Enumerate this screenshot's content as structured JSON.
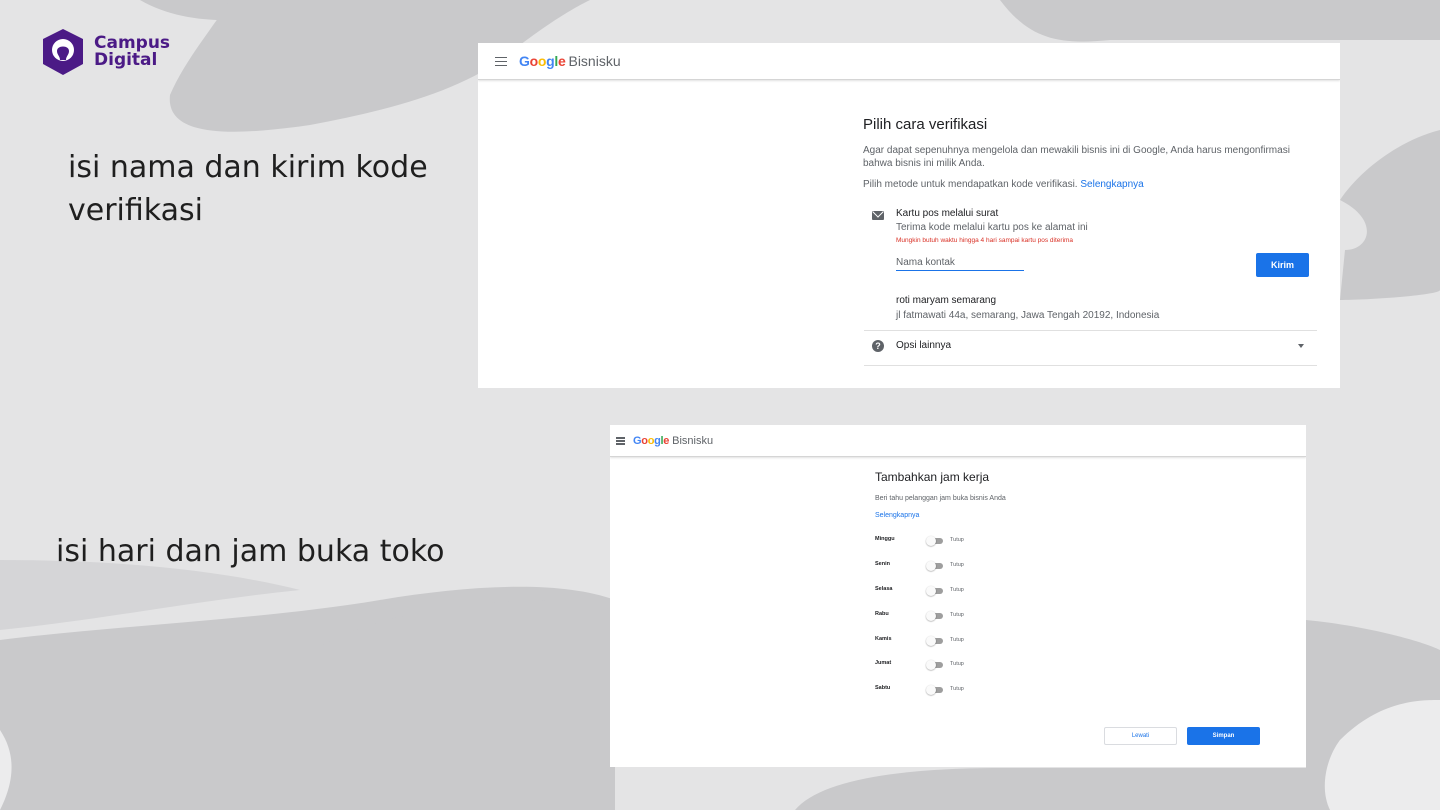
{
  "brand": {
    "name_line1": "Campus",
    "name_line2": "Digital",
    "color": "#4b1a86"
  },
  "captions": {
    "step1": "isi nama dan kirim kode verifikasi",
    "step2": "isi hari dan jam buka toko"
  },
  "screenshot1": {
    "header": {
      "google": [
        "G",
        "o",
        "o",
        "g",
        "l",
        "e"
      ],
      "product": "Bisnisku"
    },
    "title": "Pilih cara verifikasi",
    "description": "Agar dapat sepenuhnya mengelola dan mewakili bisnis ini di Google, Anda harus mengonfirmasi bahwa bisnis ini milik Anda.",
    "method_text": "Pilih metode untuk mendapatkan kode verifikasi.",
    "method_link": "Selengkapnya",
    "option": {
      "title": "Kartu pos melalui surat",
      "subtitle": "Terima kode melalui kartu pos ke alamat ini",
      "warning": "Mungkin butuh waktu hingga 4 hari sampai kartu pos diterima",
      "icon": "mail-icon"
    },
    "contact_field": {
      "placeholder": "Nama kontak",
      "value": ""
    },
    "send_button": "Kirim",
    "business": {
      "name": "roti maryam semarang",
      "address": "jl fatmawati 44a, semarang, Jawa Tengah 20192, Indonesia"
    },
    "more_options": "Opsi lainnya"
  },
  "screenshot2": {
    "header": {
      "google": [
        "G",
        "o",
        "o",
        "g",
        "l",
        "e"
      ],
      "product": "Bisnisku"
    },
    "title": "Tambahkan jam kerja",
    "description": "Beri tahu pelanggan jam buka bisnis Anda",
    "link": "Selengkapnya",
    "days": [
      {
        "day": "Minggu",
        "status": "Tutup",
        "open": false
      },
      {
        "day": "Senin",
        "status": "Tutup",
        "open": false
      },
      {
        "day": "Selasa",
        "status": "Tutup",
        "open": false
      },
      {
        "day": "Rabu",
        "status": "Tutup",
        "open": false
      },
      {
        "day": "Kamis",
        "status": "Tutup",
        "open": false
      },
      {
        "day": "Jumat",
        "status": "Tutup",
        "open": false
      },
      {
        "day": "Sabtu",
        "status": "Tutup",
        "open": false
      }
    ],
    "skip_button": "Lewati",
    "save_button": "Simpan"
  },
  "colors": {
    "accent": "#1a73e8",
    "warning": "#d93025",
    "background": "#e4e4e5",
    "blob": "#c9c9cb"
  }
}
